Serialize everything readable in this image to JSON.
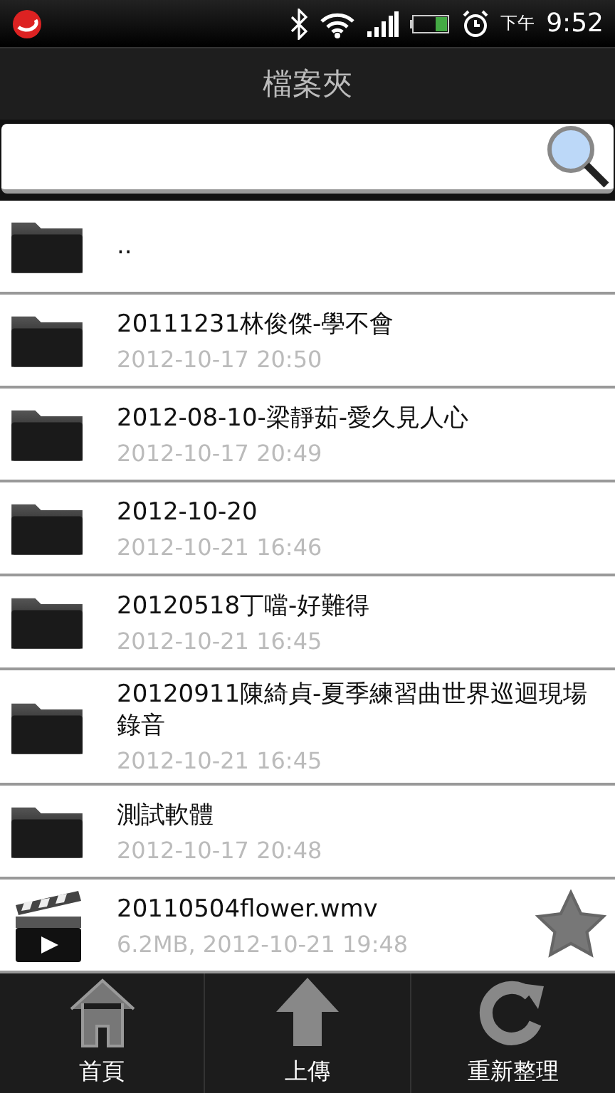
{
  "status_bar": {
    "period": "下午",
    "time": "9:52"
  },
  "title": "檔案夾",
  "items": [
    {
      "kind": "parent",
      "name": ".."
    },
    {
      "kind": "folder",
      "name": "20111231林俊傑-學不會",
      "meta": "2012-10-17 20:50"
    },
    {
      "kind": "folder",
      "name": "2012-08-10-梁靜茹-愛久見人心",
      "meta": "2012-10-17 20:49"
    },
    {
      "kind": "folder",
      "name": "2012-10-20",
      "meta": "2012-10-21 16:46"
    },
    {
      "kind": "folder",
      "name": "20120518丁噹-好難得",
      "meta": "2012-10-21 16:45"
    },
    {
      "kind": "folder",
      "name": "20120911陳綺貞-夏季練習曲世界巡迴現場錄音",
      "meta": "2012-10-21 16:45"
    },
    {
      "kind": "folder",
      "name": "測試軟體",
      "meta": "2012-10-17 20:48"
    },
    {
      "kind": "video",
      "name": "20110504flower.wmv",
      "meta": "6.2MB, 2012-10-21 19:48"
    }
  ],
  "toolbar": [
    {
      "kind": "home",
      "label": "首頁"
    },
    {
      "kind": "upload",
      "label": "上傳"
    },
    {
      "kind": "refresh",
      "label": "重新整理"
    }
  ]
}
